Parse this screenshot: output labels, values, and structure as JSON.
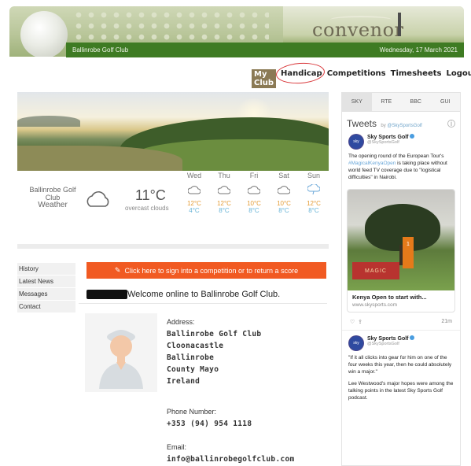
{
  "header": {
    "logo_text": "convenor",
    "club_name": "Ballinrobe Golf Club",
    "date": "Wednesday, 17 March 2021"
  },
  "nav": {
    "items": [
      {
        "label": "My Club"
      },
      {
        "label": "Handicap"
      },
      {
        "label": "Competitions"
      },
      {
        "label": "Timesheets"
      },
      {
        "label": "Logout"
      }
    ]
  },
  "weather": {
    "location_line1": "Ballinrobe Golf",
    "location_line2": "Club",
    "location_line3": "Weather",
    "temperature": "11°C",
    "description": "overcast clouds",
    "forecast": [
      {
        "day": "Wed",
        "hi": "12°C",
        "lo": "4°C",
        "icon": "cloud-icon"
      },
      {
        "day": "Thu",
        "hi": "12°C",
        "lo": "8°C",
        "icon": "cloud-icon"
      },
      {
        "day": "Fri",
        "hi": "10°C",
        "lo": "8°C",
        "icon": "cloud-icon"
      },
      {
        "day": "Sat",
        "hi": "10°C",
        "lo": "8°C",
        "icon": "cloud-icon"
      },
      {
        "day": "Sun",
        "hi": "12°C",
        "lo": "8°C",
        "icon": "rain-cloud-icon"
      }
    ]
  },
  "side_menu": {
    "items": [
      "History",
      "Latest News",
      "Messages",
      "Contact"
    ]
  },
  "main": {
    "orange_button": "Click here to sign into a competition or to return a score",
    "welcome": "Welcome online to Ballinrobe Golf Club.",
    "address_label": "Address:",
    "address_lines": [
      "Ballinrobe Golf Club",
      "Cloonacastle",
      "Ballinrobe",
      "County Mayo",
      "Ireland"
    ],
    "phone_label": "Phone Number:",
    "phone": "+353 (94) 954 1118",
    "email_label": "Email:",
    "email": "info@ballinrobegolfclub.com"
  },
  "right_panel": {
    "tabs": [
      "SKY",
      "RTE",
      "BBC",
      "GUI"
    ],
    "tweets_title": "Tweets",
    "tweets_by": "by",
    "tweets_handle": "@SkySportsGolf",
    "tweet1": {
      "name": "Sky Sports Golf",
      "handle": "@SkySportsGolf",
      "text_pre": "The opening round of the European Tour's",
      "hashtag": "#MagicalKenyaOpen",
      "text_post": "is taking place without world feed TV coverage due to \"logistical difficulties\" in Nairobi.",
      "card_title": "Kenya Open to start with...",
      "card_url": "www.skysports.com",
      "board_text": "MAGIC",
      "marker_text": "1",
      "time": "21m"
    },
    "tweet2": {
      "name": "Sky Sports Golf",
      "handle": "@SkySportsGolf",
      "text1": "\"If it all clicks into gear for him on one of the four weeks this year, then he could absolutely win a major.\"",
      "text2": "Lee Westwood's major hopes were among the talking points in the latest Sky Sports Golf podcast."
    }
  },
  "colors": {
    "green_bar": "#3e7b23",
    "orange_button": "#f15a22",
    "nav_active": "#8b7a55",
    "handicap_circle": "#d9373a"
  }
}
